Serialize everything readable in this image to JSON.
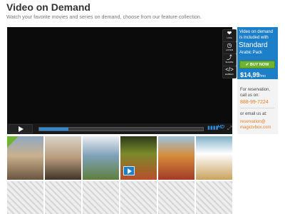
{
  "header": {
    "title": "Video on Demand",
    "subtitle": "Watch your favorite movies and series on demand, choose from our feature collection."
  },
  "player": {
    "side_icons": [
      {
        "icon": "heart-icon",
        "glyph": "❤",
        "label": "LIKE"
      },
      {
        "icon": "clock-icon",
        "glyph": "◷",
        "label": "LATER"
      },
      {
        "icon": "share-icon",
        "glyph": "⤴",
        "label": "SHARE"
      },
      {
        "icon": "embed-icon",
        "glyph": "</>",
        "label": "EMBED"
      }
    ],
    "progress": 0.18,
    "hd": "HD",
    "volume_glyph": "▮▮▮▮",
    "expand_glyph": "⤢"
  },
  "side": {
    "vod_text": "Video on demand is included with",
    "plan": "Standard",
    "pack": "Arabic Pack",
    "buy_label": "✔ BUY NOW",
    "price": "$14,99",
    "price_unit": "/mo",
    "reservation_text": "For reservation, call us on:",
    "phone": "888-99-7224",
    "email_label": "or email us at:",
    "email": "reservation@ magictvbox.com"
  },
  "thumbnails": [
    {
      "name": "thumb-movie-1"
    },
    {
      "name": "thumb-movie-2"
    },
    {
      "name": "thumb-movie-3"
    },
    {
      "name": "thumb-movie-4"
    },
    {
      "name": "thumb-movie-5"
    },
    {
      "name": "thumb-movie-6"
    }
  ],
  "colors": {
    "accent_blue": "#1c7fc7",
    "buy_green": "#6fb431",
    "link_orange": "#e67e22"
  }
}
